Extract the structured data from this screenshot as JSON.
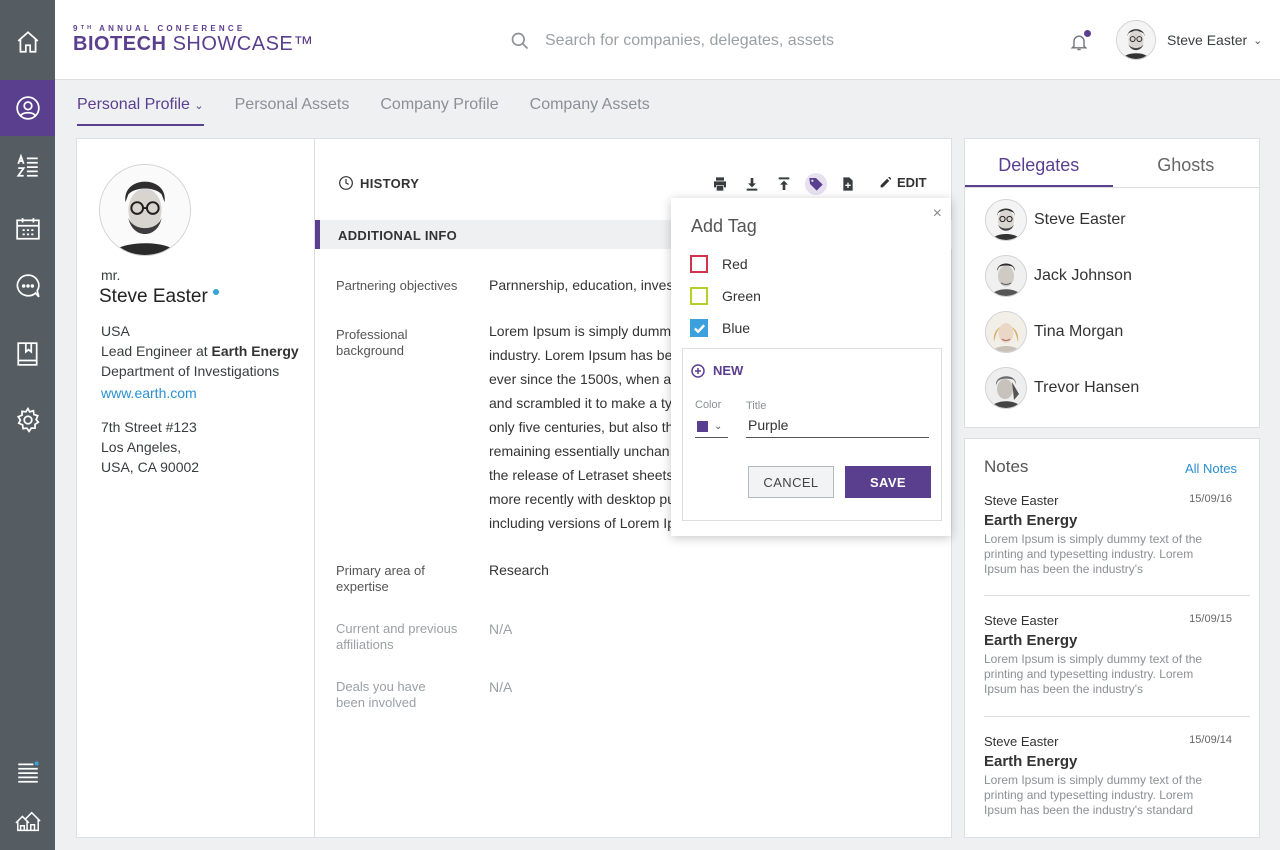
{
  "logo": {
    "top": "9ᵀᴴ ANNUAL CONFERENCE",
    "brand_bold": "BIOTECH",
    "brand_thin": "SHOWCASE™"
  },
  "search": {
    "placeholder": "Search for companies, delegates, assets"
  },
  "user": {
    "name": "Steve Easter"
  },
  "tabs": [
    "Personal Profile",
    "Personal Assets",
    "Company Profile",
    "Company Assets"
  ],
  "profile": {
    "honorific": "mr.",
    "name": "Steve Easter",
    "country": "USA",
    "role_prefix": "Lead Engineer at",
    "company": "Earth Energy",
    "department": "Department of Investigations",
    "website": "www.earth.com",
    "address1": "7th Street #123",
    "address2": "Los Angeles,",
    "address3": "USA, CA 90002"
  },
  "main": {
    "history_label": "HISTORY",
    "edit_label": "EDIT",
    "section_title": "ADDITIONAL INFO",
    "fields": [
      {
        "label": "Partnering objectives",
        "value": "Parnnership, education, invest"
      },
      {
        "label": "Professional background",
        "lines": [
          "Lorem Ipsum is simply dumm",
          "industry. Lorem Ipsum has be",
          "ever since the 1500s, when ar",
          "and scrambled it to make a ty",
          "only five centuries, but also th",
          "remaining essentially unchan",
          "the release of Letraset sheets",
          "more recently with desktop pu",
          "including versions of Lorem Ip"
        ]
      },
      {
        "label": "Primary area of expertise",
        "value": "Research"
      },
      {
        "label": "Current and previous affiliations",
        "value": "N/A"
      },
      {
        "label": "Deals you have been involved",
        "value": "N/A"
      }
    ]
  },
  "add_tag": {
    "title": "Add Tag",
    "close": "×",
    "options": [
      {
        "label": "Red",
        "color": "#d0334b",
        "checked": false
      },
      {
        "label": "Green",
        "color": "#b6cf2e",
        "checked": false
      },
      {
        "label": "Blue",
        "color": "#3ba0de",
        "checked": true
      }
    ],
    "new_label": "NEW",
    "color_label": "Color",
    "title_label": "Title",
    "title_value": "Purple",
    "selected_color": "#5b3f8f",
    "cancel": "CANCEL",
    "save": "SAVE"
  },
  "delegates": {
    "tabs": [
      "Delegates",
      "Ghosts"
    ],
    "list": [
      "Steve Easter",
      "Jack Johnson",
      "Tina Morgan",
      "Trevor Hansen"
    ]
  },
  "notes": {
    "title": "Notes",
    "all_label": "All Notes",
    "items": [
      {
        "author": "Steve Easter",
        "date": "15/09/16",
        "company": "Earth Energy",
        "body": "Lorem Ipsum is simply dummy text of the printing and typesetting industry. Lorem Ipsum has been the industry's"
      },
      {
        "author": "Steve Easter",
        "date": "15/09/15",
        "company": "Earth Energy",
        "body": "Lorem Ipsum is simply dummy text of the printing and typesetting industry. Lorem Ipsum has been the industry's"
      },
      {
        "author": "Steve Easter",
        "date": "15/09/14",
        "company": "Earth Energy",
        "body": "Lorem Ipsum is simply dummy text of the printing and typesetting industry. Lorem Ipsum has been the industry's standard"
      }
    ]
  },
  "colors": {
    "brand": "#5b3f8f",
    "nav_bg": "#555d63",
    "link": "#2a8fd0"
  }
}
